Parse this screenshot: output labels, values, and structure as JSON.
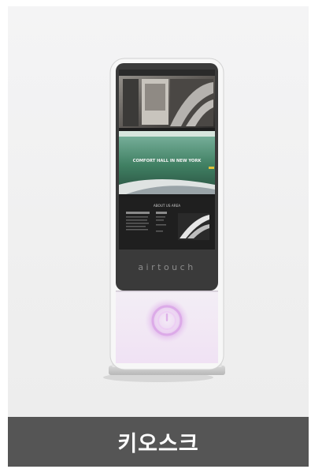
{
  "product": {
    "caption": "키오스크",
    "brand_mark": "airtouch"
  },
  "screen": {
    "panel2_heading": "COMFORT HALL IN NEW YORK",
    "panel3_heading": "ABOUT US AREA"
  },
  "colors": {
    "caption_bg": "#555555",
    "frame": "#3a3a3a",
    "lower_panel": "#efe3f4",
    "touch_ring": "#d9a4e6"
  }
}
